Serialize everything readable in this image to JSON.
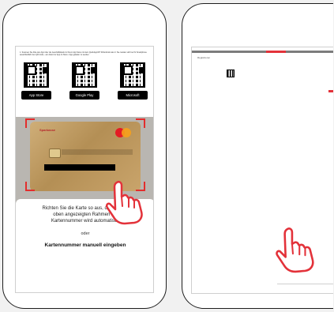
{
  "left_phone": {
    "instructions": "1. Scannen Sie bitte den App über die Geschäftsbank im Ihrem App Store mit dem QuickApp/FIT ID/Android oder\n2. Sie melden sich bei Ihr Smartphone ausschließlich den QR-Code - am direkt zur App im Store / App geladen zu werden",
    "qr_codes": [
      {
        "badge": "App Store"
      },
      {
        "badge": "Google Play"
      },
      {
        "badge": "Microsoft"
      }
    ],
    "card": {
      "bank_logo": "Sparkasse"
    },
    "hint_text": "Richten Sie die Karte so aus, dass sie im oben angezeigten Rahmen ist. Kartennummer wird automatisch",
    "or_text": "oder",
    "manual_button": "Kartennummer manuell eingeben"
  },
  "right_phone": {
    "mini_title": "Registrieren"
  },
  "colors": {
    "accent": "#e3323a",
    "frame": "#e32d2d",
    "background": "#f1f1f1"
  }
}
